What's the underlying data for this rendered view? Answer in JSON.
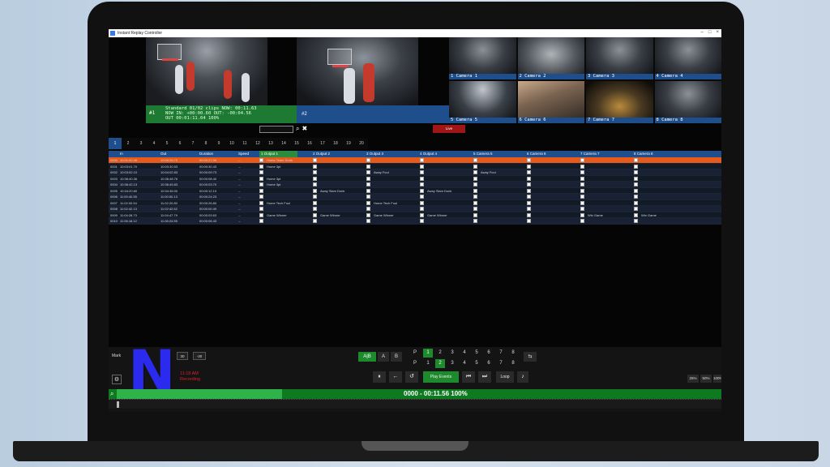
{
  "window": {
    "title": "Instant Replay Controller"
  },
  "program": {
    "tag": "#1",
    "info_line1": "Standard  01/02 clips   NOW: 00:11.63",
    "info_line2": "NOW  IN: +00:00.60  OUT: -00:04.56",
    "info_line3": "OUT  00:01:11.04        100%"
  },
  "preview": {
    "tag": "#2"
  },
  "cameras": [
    {
      "label": "1 Camera 1"
    },
    {
      "label": "2 Camera 2"
    },
    {
      "label": "3 Camera 3"
    },
    {
      "label": "4 Camera 4"
    },
    {
      "label": "5 Camera 5"
    },
    {
      "label": "6 Camera 6"
    },
    {
      "label": "7 Camera 7"
    },
    {
      "label": "8 Camera 8"
    }
  ],
  "live_button": "Live",
  "tabs": [
    "1",
    "2",
    "3",
    "4",
    "5",
    "6",
    "7",
    "8",
    "9",
    "10",
    "11",
    "12",
    "13",
    "14",
    "15",
    "16",
    "17",
    "18",
    "19",
    "20"
  ],
  "grid": {
    "headers": [
      "In",
      "Out",
      "Duration",
      "Speed",
      "1 Output 1",
      "2 Output 2",
      "3 Output 3",
      "4 Output 4",
      "5 Camera 5",
      "6 Camera 6",
      "7 Camera 7",
      "8 Camera 8"
    ],
    "rows": [
      {
        "id": "0000",
        "in": "10:01:00.46",
        "out": "10:06:26.70",
        "dur": "00:00:27.06",
        "speed": "--",
        "o1": "Home Team Dunk",
        "o2": "",
        "o3": "",
        "o4": "",
        "c5": "",
        "c6": "",
        "c7": "",
        "c8": ""
      },
      {
        "id": "0001",
        "in": "10:03:01.70",
        "out": "10:03:30.53",
        "dur": "00:00:30.43",
        "speed": "--",
        "o1": "Home 3pt",
        "o2": "",
        "o3": "",
        "o4": "",
        "c5": "",
        "c6": "",
        "c7": "",
        "c8": ""
      },
      {
        "id": "0002",
        "in": "10:03:52.10",
        "out": "10:04:02.83",
        "dur": "00:00:09.73",
        "speed": "--",
        "o1": "",
        "o2": "",
        "o3": "Away Foul",
        "o4": "",
        "c5": "Away Foul",
        "c6": "",
        "c7": "",
        "c8": ""
      },
      {
        "id": "0003",
        "in": "10:36:40.36",
        "out": "10:36:48.76",
        "dur": "00:00:08.40",
        "speed": "--",
        "o1": "Home 3pt",
        "o2": "",
        "o3": "",
        "o4": "",
        "c5": "",
        "c6": "",
        "c7": "",
        "c8": ""
      },
      {
        "id": "0004",
        "in": "10:36:42.13",
        "out": "10:36:45.83",
        "dur": "00:00:03.70",
        "speed": "--",
        "o1": "Home 3pt",
        "o2": "",
        "o3": "",
        "o4": "",
        "c5": "",
        "c6": "",
        "c7": "",
        "c8": ""
      },
      {
        "id": "0005",
        "in": "10:34:20.80",
        "out": "10:34:36.00",
        "dur": "00:00:12.10",
        "speed": "--",
        "o1": "",
        "o2": "Away Slam Dunk",
        "o3": "",
        "o4": "Away Slam Dunk",
        "c5": "",
        "c6": "",
        "c7": "",
        "c8": ""
      },
      {
        "id": "0006",
        "in": "11:00:40.55",
        "out": "11:00:50.13",
        "dur": "00:00:24.23",
        "speed": "--",
        "o1": "",
        "o2": "",
        "o3": "",
        "o4": "",
        "c5": "",
        "c6": "",
        "c7": "",
        "c8": ""
      },
      {
        "id": "0007",
        "in": "11:02:00.54",
        "out": "11:02:20.80",
        "dur": "00:00:26.80",
        "speed": "--",
        "o1": "Home Tech Foul",
        "o2": "",
        "o3": "Home Tech Foul",
        "o4": "",
        "c5": "",
        "c6": "",
        "c7": "",
        "c8": ""
      },
      {
        "id": "0008",
        "in": "11:02:42.13",
        "out": "11:02:42.62",
        "dur": "00:00:00.49",
        "speed": "--",
        "o1": "",
        "o2": "",
        "o3": "",
        "o4": "",
        "c5": "",
        "c6": "",
        "c7": "",
        "c8": ""
      },
      {
        "id": "0009",
        "in": "11:04:28.73",
        "out": "11:04:47.79",
        "dur": "00:00:03.63",
        "speed": "--",
        "o1": "Game Winner",
        "o2": "Game Winner",
        "o3": "Game Winner",
        "o4": "Game Winner",
        "c5": "",
        "c6": "",
        "c7": "Win Game",
        "c8": "Win Game"
      },
      {
        "id": "0010",
        "in": "11:06:18.12",
        "out": "11:06:24.55",
        "dur": "00:00:06.43",
        "speed": "--",
        "o1": "",
        "o2": "",
        "o3": "",
        "o4": "",
        "c5": "",
        "c6": "",
        "c7": "",
        "c8": ""
      }
    ]
  },
  "controls": {
    "mark_label": "Mark",
    "btn_30": "30",
    "btn_m30": "-30",
    "red_line1": "11:18 AM",
    "red_line2": "Recording",
    "all_label": "A|B",
    "a_label": "A",
    "b_label": "B",
    "p_label": "P",
    "pnums": [
      "1",
      "2",
      "3",
      "4",
      "5",
      "6",
      "7",
      "8"
    ],
    "play_events": "Play Events",
    "loop": "Loop",
    "zoom": [
      "25%",
      "50%",
      "100%"
    ],
    "readout": "0000 - 00:11.56   100%",
    "progress_fraction": 0.27
  },
  "colors": {
    "accent_blue": "#1f4e8c",
    "accent_green": "#1e8a2e",
    "selected_row": "#e65a1e",
    "live_red": "#a01515"
  }
}
